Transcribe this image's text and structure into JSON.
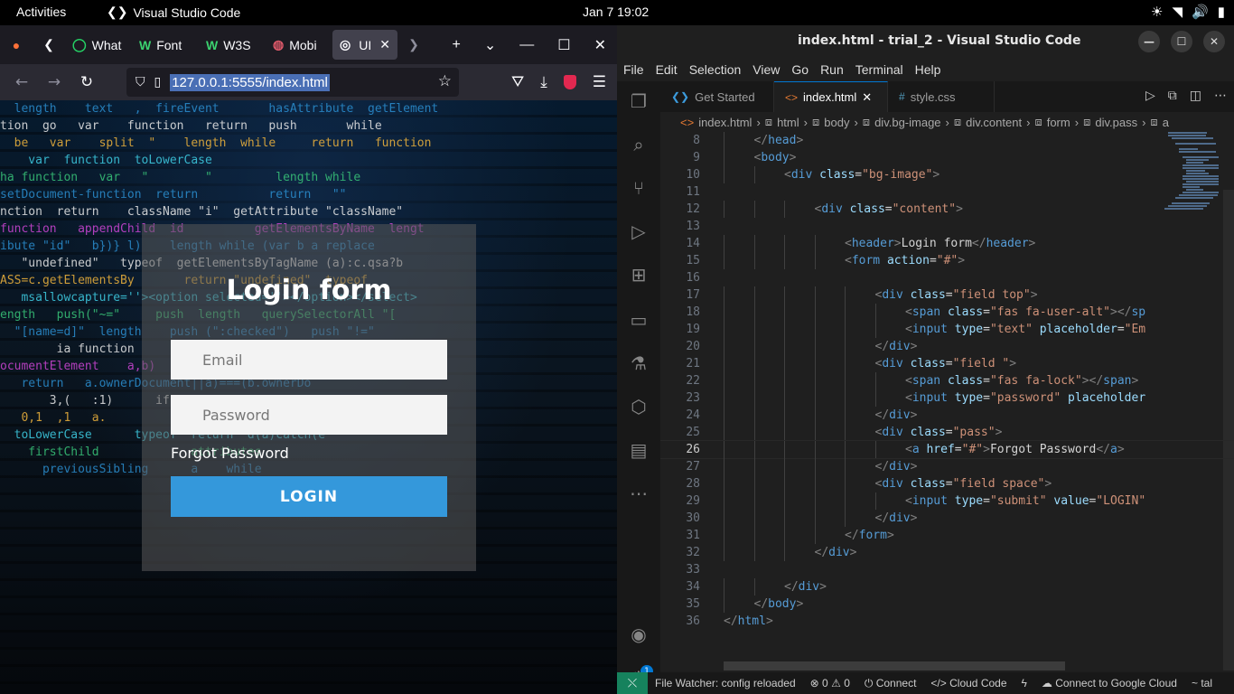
{
  "topbar": {
    "activities": "Activities",
    "app_name": "Visual Studio Code",
    "clock": "Jan 7  19:02",
    "tray_icons": [
      "brightness-icon",
      "wifi-icon",
      "volume-icon",
      "battery-icon"
    ]
  },
  "firefox": {
    "tabs": [
      {
        "favicon": "whatsapp",
        "label": "What"
      },
      {
        "favicon": "W",
        "label": "Font"
      },
      {
        "favicon": "W",
        "label": "W3S"
      },
      {
        "favicon": "mobile",
        "label": "Mobi"
      },
      {
        "favicon": "radio",
        "label": "UI",
        "active": true
      }
    ],
    "url": "127.0.0.1:5555/index.html"
  },
  "login_page": {
    "title": "Login form",
    "email_placeholder": "Email",
    "password_placeholder": "Password",
    "forgot_link": "Forgot Password",
    "button_label": "LOGIN"
  },
  "vscode": {
    "window_title": "index.html - trial_2 - Visual Studio Code",
    "menu": [
      "File",
      "Edit",
      "Selection",
      "View",
      "Go",
      "Run",
      "Terminal",
      "Help"
    ],
    "tabs": [
      {
        "label": "Get Started",
        "icon": "vscode-icon"
      },
      {
        "label": "index.html",
        "icon": "html-icon",
        "active": true
      },
      {
        "label": "style.css",
        "icon": "hash-icon"
      }
    ],
    "breadcrumbs": [
      "index.html",
      "html",
      "body",
      "div.bg-image",
      "div.content",
      "form",
      "div.pass",
      "a"
    ],
    "account_badge": "1",
    "code_lines": [
      {
        "n": "8",
        "indent": 1,
        "html": "<span class=\"pn\">&lt;/</span><span class=\"tg\">head</span><span class=\"pn\">&gt;</span>"
      },
      {
        "n": "9",
        "indent": 1,
        "html": "<span class=\"pn\">&lt;</span><span class=\"tg\">body</span><span class=\"pn\">&gt;</span>"
      },
      {
        "n": "10",
        "indent": 2,
        "html": "<span class=\"pn\">&lt;</span><span class=\"tg\">div</span> <span class=\"at\">class</span>=<span class=\"st\">\"bg-image\"</span><span class=\"pn\">&gt;</span>"
      },
      {
        "n": "11",
        "indent": 0,
        "html": ""
      },
      {
        "n": "12",
        "indent": 3,
        "html": "<span class=\"pn\">&lt;</span><span class=\"tg\">div</span> <span class=\"at\">class</span>=<span class=\"st\">\"content\"</span><span class=\"pn\">&gt;</span>"
      },
      {
        "n": "13",
        "indent": 0,
        "html": ""
      },
      {
        "n": "14",
        "indent": 4,
        "html": "<span class=\"pn\">&lt;</span><span class=\"tg\">header</span><span class=\"pn\">&gt;</span>Login form<span class=\"pn\">&lt;/</span><span class=\"tg\">header</span><span class=\"pn\">&gt;</span>"
      },
      {
        "n": "15",
        "indent": 4,
        "html": "<span class=\"pn\">&lt;</span><span class=\"tg\">form</span> <span class=\"at\">action</span>=<span class=\"st\">\"#\"</span><span class=\"pn\">&gt;</span>"
      },
      {
        "n": "16",
        "indent": 0,
        "html": ""
      },
      {
        "n": "17",
        "indent": 5,
        "html": "<span class=\"pn\">&lt;</span><span class=\"tg\">div</span> <span class=\"at\">class</span>=<span class=\"st\">\"field top\"</span><span class=\"pn\">&gt;</span>"
      },
      {
        "n": "18",
        "indent": 6,
        "html": "<span class=\"pn\">&lt;</span><span class=\"tg\">span</span> <span class=\"at\">class</span>=<span class=\"st\">\"fas fa-user-alt\"</span><span class=\"pn\">&gt;&lt;/</span><span class=\"tg\">sp</span>"
      },
      {
        "n": "19",
        "indent": 6,
        "html": "<span class=\"pn\">&lt;</span><span class=\"tg\">input</span> <span class=\"at\">type</span>=<span class=\"st\">\"text\"</span> <span class=\"at\">placeholder</span>=<span class=\"st\">\"Em</span>"
      },
      {
        "n": "20",
        "indent": 5,
        "html": "<span class=\"pn\">&lt;/</span><span class=\"tg\">div</span><span class=\"pn\">&gt;</span>"
      },
      {
        "n": "21",
        "indent": 5,
        "html": "<span class=\"pn\">&lt;</span><span class=\"tg\">div</span> <span class=\"at\">class</span>=<span class=\"st\">\"field \"</span><span class=\"pn\">&gt;</span>"
      },
      {
        "n": "22",
        "indent": 6,
        "html": "<span class=\"pn\">&lt;</span><span class=\"tg\">span</span> <span class=\"at\">class</span>=<span class=\"st\">\"fas fa-lock\"</span><span class=\"pn\">&gt;&lt;/</span><span class=\"tg\">span</span><span class=\"pn\">&gt;</span>"
      },
      {
        "n": "23",
        "indent": 6,
        "html": "<span class=\"pn\">&lt;</span><span class=\"tg\">input</span> <span class=\"at\">type</span>=<span class=\"st\">\"password\"</span> <span class=\"at\">placeholder</span>"
      },
      {
        "n": "24",
        "indent": 5,
        "html": "<span class=\"pn\">&lt;/</span><span class=\"tg\">div</span><span class=\"pn\">&gt;</span>"
      },
      {
        "n": "25",
        "indent": 5,
        "html": "<span class=\"pn\">&lt;</span><span class=\"tg\">div</span> <span class=\"at\">class</span>=<span class=\"st\">\"pass\"</span><span class=\"pn\">&gt;</span>"
      },
      {
        "n": "26",
        "indent": 6,
        "html": "<span class=\"pn\">&lt;</span><span class=\"tg\">a</span> <span class=\"at\">href</span>=<span class=\"st\">\"#\"</span><span class=\"pn\">&gt;</span>Forgot Password<span class=\"pn\">&lt;/</span><span class=\"tg\">a</span><span class=\"pn\">&gt;</span>",
        "current": true
      },
      {
        "n": "27",
        "indent": 5,
        "html": "<span class=\"pn\">&lt;/</span><span class=\"tg\">div</span><span class=\"pn\">&gt;</span>"
      },
      {
        "n": "28",
        "indent": 5,
        "html": "<span class=\"pn\">&lt;</span><span class=\"tg\">div</span> <span class=\"at\">class</span>=<span class=\"st\">\"field space\"</span><span class=\"pn\">&gt;</span>"
      },
      {
        "n": "29",
        "indent": 6,
        "html": "<span class=\"pn\">&lt;</span><span class=\"tg\">input</span> <span class=\"at\">type</span>=<span class=\"st\">\"submit\"</span> <span class=\"at\">value</span>=<span class=\"st\">\"LOGIN\"</span>"
      },
      {
        "n": "30",
        "indent": 5,
        "html": "<span class=\"pn\">&lt;/</span><span class=\"tg\">div</span><span class=\"pn\">&gt;</span>"
      },
      {
        "n": "31",
        "indent": 4,
        "html": "<span class=\"pn\">&lt;/</span><span class=\"tg\">form</span><span class=\"pn\">&gt;</span>"
      },
      {
        "n": "32",
        "indent": 3,
        "html": "<span class=\"pn\">&lt;/</span><span class=\"tg\">div</span><span class=\"pn\">&gt;</span>"
      },
      {
        "n": "33",
        "indent": 0,
        "html": ""
      },
      {
        "n": "34",
        "indent": 2,
        "html": "<span class=\"pn\">&lt;/</span><span class=\"tg\">div</span><span class=\"pn\">&gt;</span>"
      },
      {
        "n": "35",
        "indent": 1,
        "html": "<span class=\"pn\">&lt;/</span><span class=\"tg\">body</span><span class=\"pn\">&gt;</span>"
      },
      {
        "n": "36",
        "indent": 0,
        "html": "<span class=\"pn\">&lt;/</span><span class=\"tg\">html</span><span class=\"pn\">&gt;</span>"
      }
    ],
    "status": {
      "file_watcher": "File Watcher: config reloaded",
      "errors": "0",
      "warnings": "0",
      "connect": "Connect",
      "cloud_code": "Cloud Code",
      "google_cloud": "Connect to Google Cloud",
      "tail": "tal"
    }
  },
  "background_code": [
    "  length    text   ,  fireEvent       hasAttribute  getElement",
    "tion  go   var    function   return   push       while  ",
    "  be   var    split  \"    length  while     return   function",
    "    var  function  toLowerCase  ",
    "ha function   var   \"        \"         length while    ",
    "setDocument-function  return          return   \"\"  ",
    "nction  return    className \"i\"  getAttribute \"className\"",
    "function   appendChild  id          getElementsByName  lengt",
    "ibute \"id\"   b})} l)    length while (var b a replace",
    "   \"undefined\"   typeof  getElementsByTagName (a):c.qsa?b",
    "ASS=c.getElementsBy       return \"undefined\"  typeof  ",
    "   msallowcapture=''><option selected=''></option></select>",
    "ength   push(\"~=\"     push  length   querySelectorAll \"[",
    "  \"[name=d]\"  length    push (\":checked\")   push \"!=\"",
    "        ia function           querySelectorAll(\":enabled\"",
    "ocumentElement    a,b)  return    call(a,\"[s!='']:x\")",
    "   return   a.ownerDocument||a)===(b.ownerDo",
    "       3,(   :1)      if(a==b)return    0,0.var c,d=0,e",
    "   0,1  ,1   a.            1,0),n(n),a.matches functio",
    "  toLowerCase      typeof  return  d(a)catch(e",
    "    firstChild             attributes  ",
    "      previousSibling      a    while   "
  ]
}
